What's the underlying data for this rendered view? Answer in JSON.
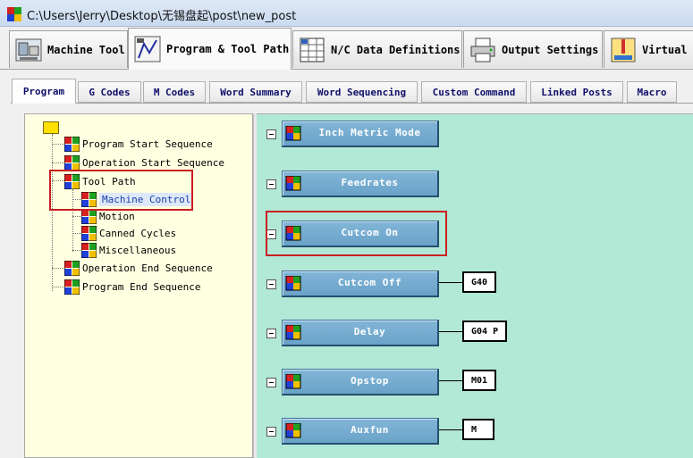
{
  "window": {
    "title": "C:\\Users\\Jerry\\Desktop\\无锡盘起\\post\\new_post"
  },
  "main_tabs": [
    {
      "label": "Machine Tool",
      "icon": "machine-tool-icon"
    },
    {
      "label": "Program & Tool Path",
      "icon": "program-tool-path-icon",
      "active": true
    },
    {
      "label": "N/C Data Definitions",
      "icon": "nc-data-icon"
    },
    {
      "label": "Output Settings",
      "icon": "printer-icon"
    },
    {
      "label": "Virtual M",
      "icon": "virtual-machine-icon"
    }
  ],
  "sub_tabs": [
    {
      "label": "Program",
      "active": true
    },
    {
      "label": "G Codes"
    },
    {
      "label": "M Codes"
    },
    {
      "label": "Word Summary"
    },
    {
      "label": "Word Sequencing"
    },
    {
      "label": "Custom Command"
    },
    {
      "label": "Linked Posts"
    },
    {
      "label": "Macro"
    }
  ],
  "tree": {
    "items": [
      {
        "label": "Program Start Sequence"
      },
      {
        "label": "Operation Start Sequence"
      },
      {
        "label": "Tool Path"
      },
      {
        "label": "Machine Control",
        "selected": true
      },
      {
        "label": "Motion"
      },
      {
        "label": "Canned Cycles"
      },
      {
        "label": "Miscellaneous"
      },
      {
        "label": "Operation End Sequence"
      },
      {
        "label": "Program End Sequence"
      }
    ]
  },
  "commands": [
    {
      "label": "Inch Metric Mode",
      "code": ""
    },
    {
      "label": "Feedrates",
      "code": ""
    },
    {
      "label": "Cutcom On",
      "code": ""
    },
    {
      "label": "Cutcom Off",
      "code": "G40"
    },
    {
      "label": "Delay",
      "code": "G04 P"
    },
    {
      "label": "Opstop",
      "code": "M01"
    },
    {
      "label": "Auxfun",
      "code": "M"
    }
  ],
  "colors": {
    "tree_background": "#ffffe1",
    "panel_background": "#b2e8d6",
    "button_blue": "#6aa2c8",
    "highlight_red": "#c82020"
  }
}
